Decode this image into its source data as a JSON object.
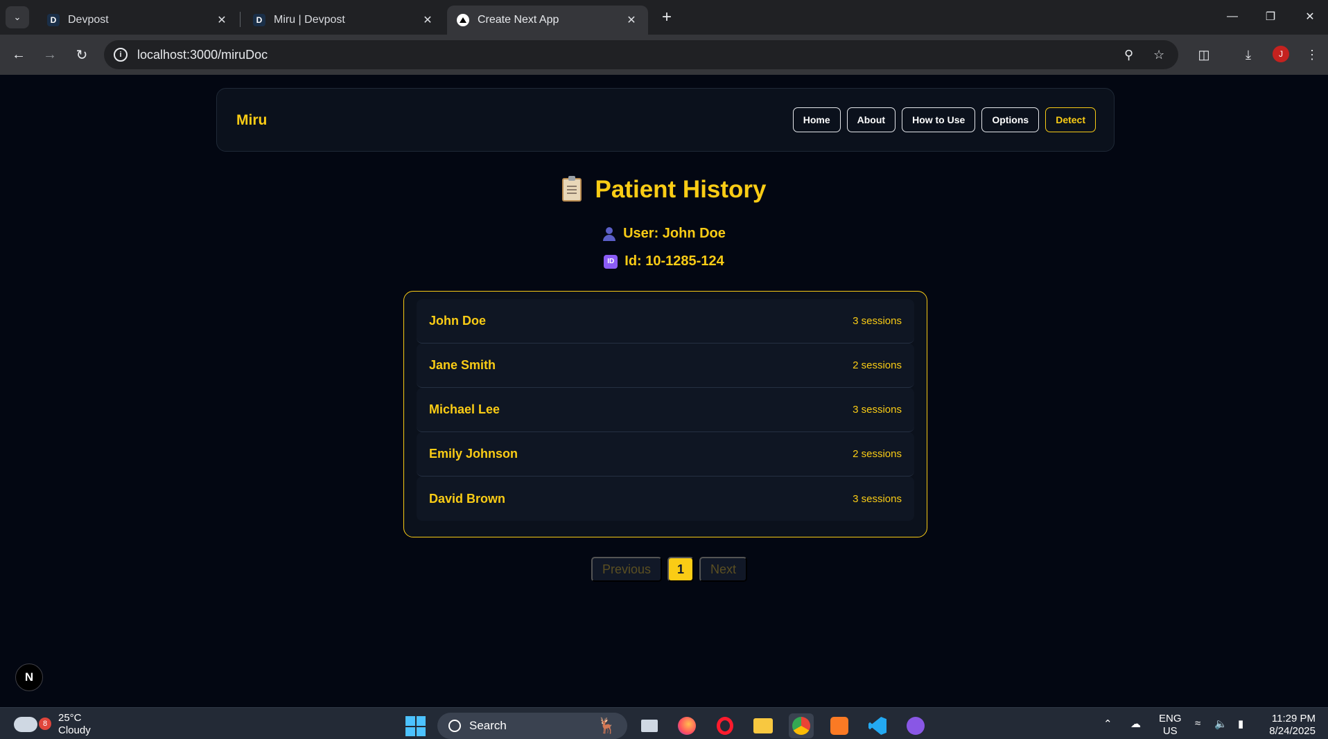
{
  "browser": {
    "tabs": [
      {
        "title": "Devpost",
        "favicon": "D"
      },
      {
        "title": "Miru | Devpost",
        "favicon": "D"
      },
      {
        "title": "Create Next App",
        "favicon": "next-triangle-icon"
      }
    ],
    "url": "localhost:3000/miruDoc",
    "profile_initial": "J"
  },
  "app": {
    "brand": "Miru",
    "nav": [
      "Home",
      "About",
      "How to Use",
      "Options",
      "Detect"
    ],
    "accent_color": "#facc15"
  },
  "page": {
    "title": "Patient History",
    "user_line": "User: John Doe",
    "id_line": "Id: 10-1285-124",
    "patients": [
      {
        "name": "John Doe",
        "sessions": "3 sessions"
      },
      {
        "name": "Jane Smith",
        "sessions": "2 sessions"
      },
      {
        "name": "Michael Lee",
        "sessions": "3 sessions"
      },
      {
        "name": "Emily Johnson",
        "sessions": "2 sessions"
      },
      {
        "name": "David Brown",
        "sessions": "3 sessions"
      }
    ],
    "pagination": {
      "previous": "Previous",
      "current": "1",
      "next": "Next"
    }
  },
  "devtools_badge": "N",
  "taskbar": {
    "weather_badge": "8",
    "temperature": "25°C",
    "condition": "Cloudy",
    "search_placeholder": "Search",
    "lang_top": "ENG",
    "lang_bottom": "US",
    "time": "11:29 PM",
    "date": "8/24/2025"
  }
}
